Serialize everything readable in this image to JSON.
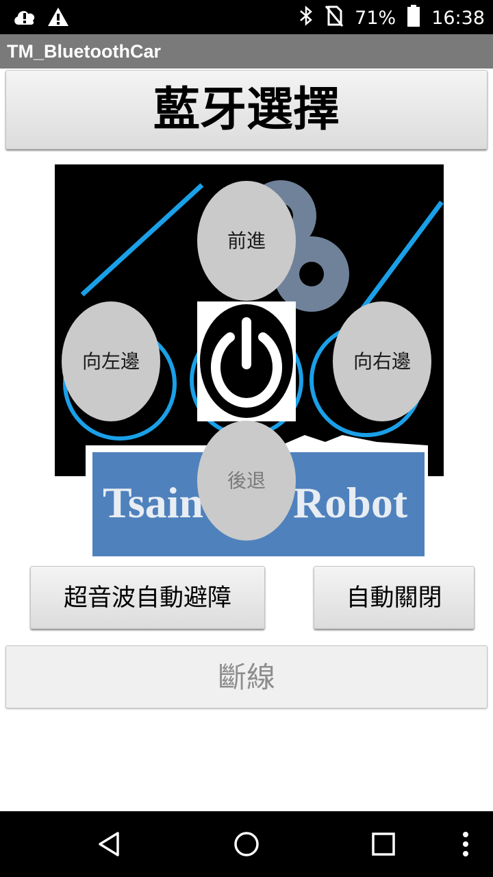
{
  "status_bar": {
    "battery": "71%",
    "time": "16:38",
    "icons": [
      "cloud-alert-icon",
      "warning-icon",
      "bluetooth-icon",
      "no-sim-icon",
      "battery-icon"
    ]
  },
  "app": {
    "title": "TM_BluetoothCar"
  },
  "buttons": {
    "bluetooth_select": "藍牙選擇",
    "forward": "前進",
    "left": "向左邊",
    "right": "向右邊",
    "backward": "後退",
    "ultrasonic": "超音波自動避障",
    "auto_off": "自動關閉",
    "disconnect": "斷線"
  },
  "logo": {
    "text_left": "Tsain",
    "text_right": "Robot"
  },
  "nav": {
    "icons": [
      "back-icon",
      "home-icon",
      "recents-icon",
      "overflow-menu-icon"
    ]
  },
  "colors": {
    "title_bar": "#7a7a7a",
    "logo_banner": "#4f81bd",
    "accent_line": "#1aa0e8"
  }
}
